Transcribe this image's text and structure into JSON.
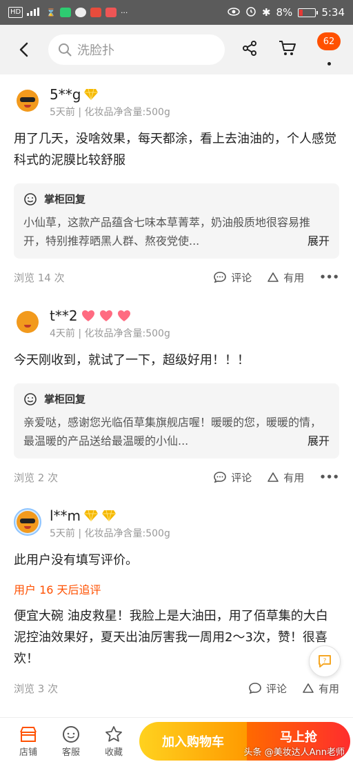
{
  "status_bar": {
    "left_chips": [
      "HD",
      "4G"
    ],
    "battery": "8%",
    "time": "5:34"
  },
  "header": {
    "search_placeholder": "洗脸扑",
    "cart_badge": "62"
  },
  "reviews": [
    {
      "name": "5**g",
      "meta": "5天前 | 化妆品净含量:500g",
      "text": "用了几天，没啥效果，每天都涂，看上去油油的，个人感觉科式的泥膜比较舒服",
      "reply_title": "掌柜回复",
      "reply_text": "小仙草，这款产品蕴含七味本草菁萃，奶油般质地很容易推开，特别推荐晒黑人群、熬夜党使...",
      "reply_expand": "展开",
      "views": "浏览 14 次",
      "comment": "评论",
      "useful": "有用"
    },
    {
      "name": "t**2",
      "meta": "4天前 | 化妆品净含量:500g",
      "text": "今天刚收到，就试了一下，超级好用！！！",
      "reply_title": "掌柜回复",
      "reply_text": "亲爱哒，感谢您光临佰草集旗舰店喔！暖暖的您，暖暖的情，最温暖的产品送给最温暖的小仙...",
      "reply_expand": "展开",
      "views": "浏览 2 次",
      "comment": "评论",
      "useful": "有用"
    },
    {
      "name": "l**m",
      "meta": "5天前 | 化妆品净含量:500g",
      "text": "此用户没有填写评价。",
      "followup_label": "用户 16 天后追评",
      "followup_text": "便宜大碗 油皮救星！我脸上是大油田，用了佰草集的大白泥控油效果好，夏天出油厉害我一周用2～3次，赞！很喜欢！",
      "views": "浏览 3 次",
      "comment": "评论",
      "useful": "有用"
    }
  ],
  "bottom_bar": {
    "shop": "店铺",
    "service": "客服",
    "favorite": "收藏",
    "add_cart": "加入购物车",
    "buy_now": "马上抢"
  },
  "watermark": "头条 @美妆达人Ann老师",
  "colors": {
    "accent": "#ff5000",
    "cart_button": "#ffb300",
    "buy_button": "#ff3b2f"
  }
}
